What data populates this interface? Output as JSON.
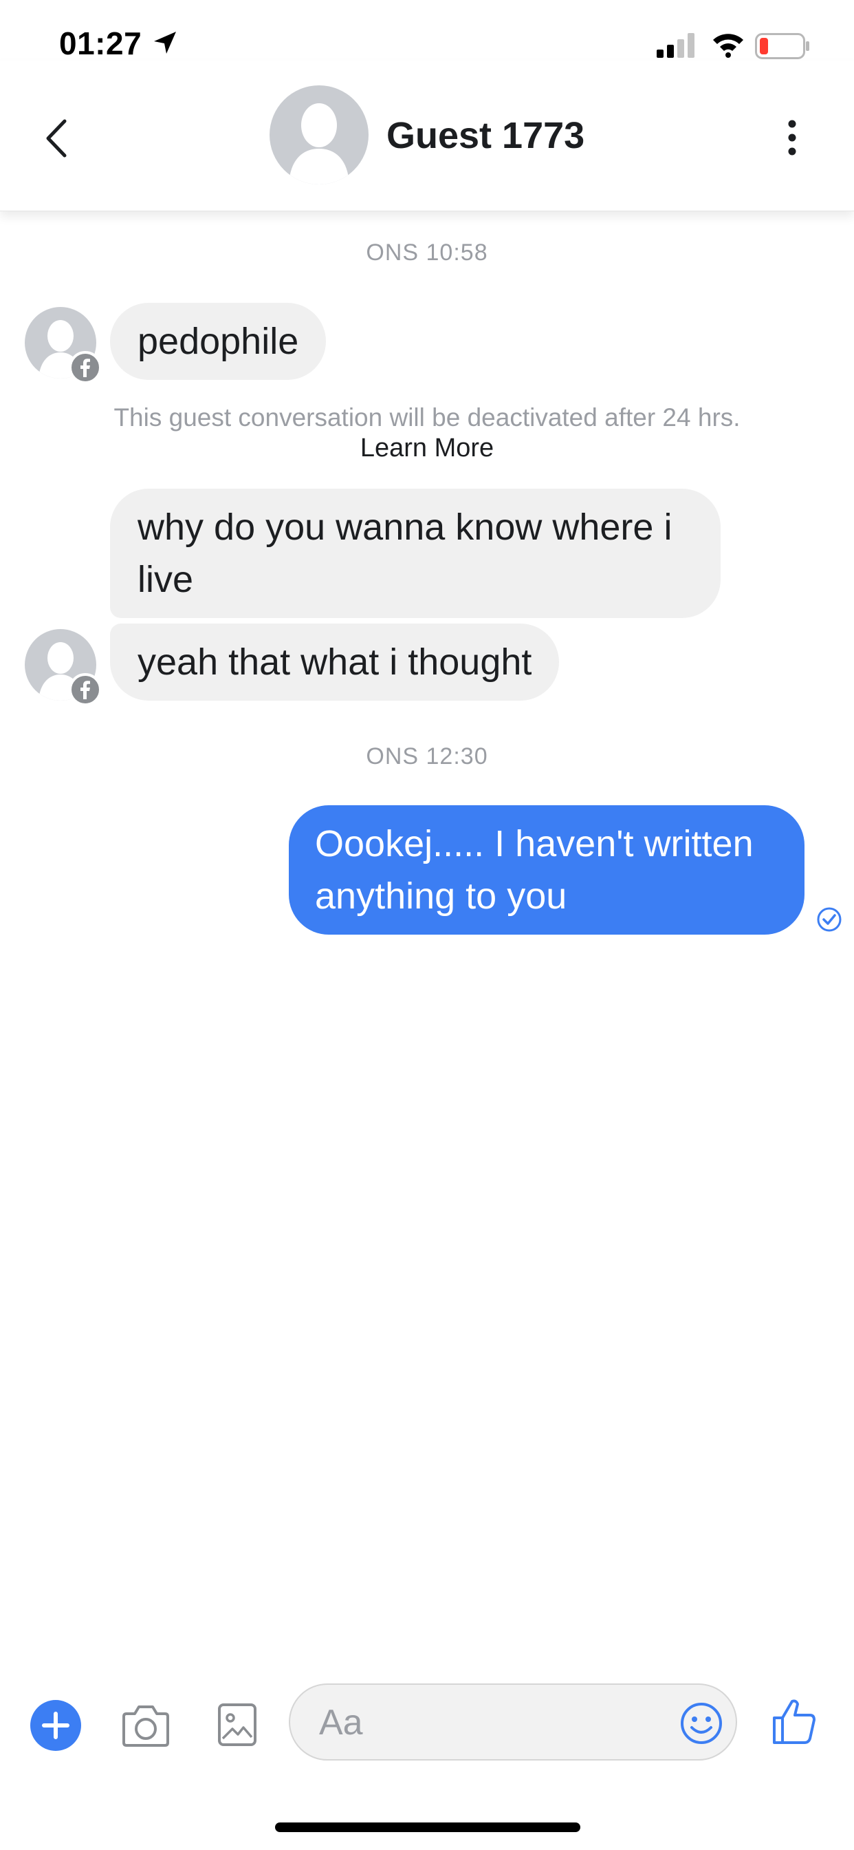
{
  "status_bar": {
    "time": "01:27"
  },
  "header": {
    "contact_name": "Guest 1773"
  },
  "conversation": {
    "timestamp_1": "ONS 10:58",
    "timestamp_2": "ONS 12:30",
    "notice": "This guest conversation will be deactivated after 24 hrs.",
    "learn_more": "Learn More",
    "messages": [
      {
        "sender": "them",
        "text": "pedophile"
      },
      {
        "sender": "them",
        "line1": "why do you wanna know where i",
        "line2": "live"
      },
      {
        "sender": "them",
        "text": "yeah that what i thought"
      },
      {
        "sender": "me",
        "line1": "Oookej..... I haven't written",
        "line2": "anything to you"
      }
    ]
  },
  "composer": {
    "placeholder": "Aa"
  },
  "colors": {
    "accent": "#3c7ef3",
    "incoming_bubble": "#f0f0f0",
    "muted_text": "#9a9da3"
  }
}
